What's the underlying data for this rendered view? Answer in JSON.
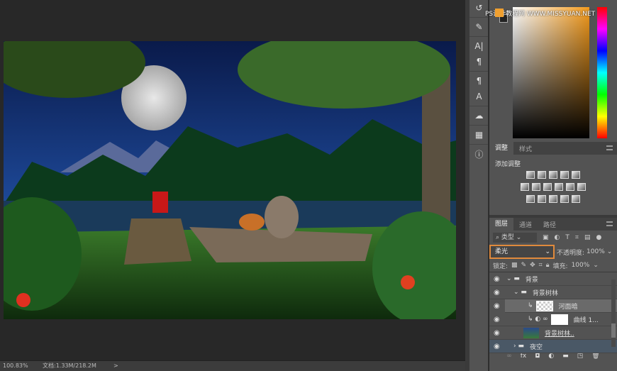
{
  "status": {
    "zoom": "100.83%",
    "doc": "文档:1.33M/218.2M",
    "arrow": ">"
  },
  "watermark": "PS设计教程网 WWW.MISSYUAN.NET",
  "colors": {
    "accent": "#e08a3c",
    "picker_hue": "#f39a1c",
    "foreground": "#f0a030",
    "background": "#222222"
  },
  "adjust_panel": {
    "tabs": [
      "调整",
      "样式"
    ],
    "title": "添加调整",
    "icons": [
      "brightness-icon",
      "levels-icon",
      "curves-icon",
      "exposure-icon",
      "vibrance-icon",
      "hsl-icon",
      "color-balance-icon",
      "bw-icon",
      "photo-filter-icon",
      "channel-mixer-icon",
      "color-lookup-icon",
      "invert-icon",
      "posterize-icon",
      "threshold-icon",
      "gradient-map-icon",
      "selective-color-icon"
    ]
  },
  "layers_panel": {
    "tabs": [
      "图层",
      "通道",
      "路径"
    ],
    "filter": "类型",
    "blend_mode": "柔光",
    "opacity_label": "不透明度:",
    "opacity": "100%",
    "lock_label": "锁定:",
    "fill_label": "填充:",
    "fill": "100%",
    "layers": [
      {
        "name": "背景",
        "type": "group",
        "indent": 0,
        "expanded": true
      },
      {
        "name": "背景树林",
        "type": "group",
        "indent": 1,
        "expanded": true
      },
      {
        "name": "河面暗",
        "type": "layer",
        "indent": 2,
        "selected": true
      },
      {
        "name": "曲线 1...",
        "type": "adjustment",
        "indent": 2
      },
      {
        "name": "背景树林..",
        "type": "smart",
        "indent": 2
      },
      {
        "name": "夜空",
        "type": "group",
        "indent": 0,
        "expanded": false
      }
    ],
    "footer_icons": [
      "link-icon",
      "fx-icon",
      "mask-icon",
      "adjustment-icon",
      "folder-icon",
      "new-layer-icon",
      "trash-icon"
    ]
  }
}
